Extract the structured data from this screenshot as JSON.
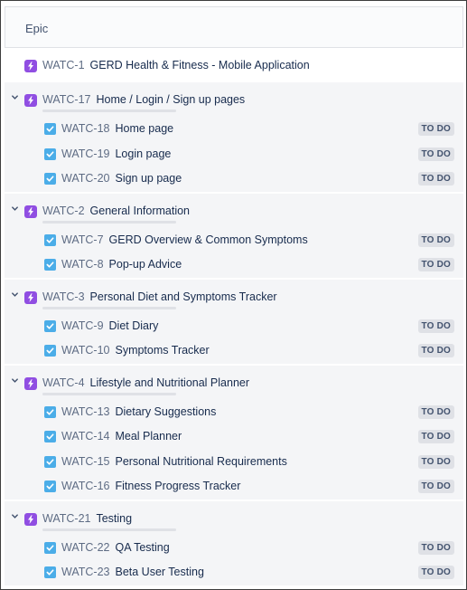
{
  "header": {
    "title": "Epic"
  },
  "epics": [
    {
      "key": "WATC-1",
      "summary": "GERD Health & Fitness - Mobile Application",
      "expanded": false,
      "stories": []
    },
    {
      "key": "WATC-17",
      "summary": "Home / Login / Sign up pages",
      "expanded": true,
      "stories": [
        {
          "key": "WATC-18",
          "summary": "Home page",
          "status": "TO DO"
        },
        {
          "key": "WATC-19",
          "summary": "Login page",
          "status": "TO DO"
        },
        {
          "key": "WATC-20",
          "summary": "Sign up page",
          "status": "TO DO"
        }
      ]
    },
    {
      "key": "WATC-2",
      "summary": "General Information",
      "expanded": true,
      "stories": [
        {
          "key": "WATC-7",
          "summary": "GERD Overview & Common Symptoms",
          "status": "TO DO"
        },
        {
          "key": "WATC-8",
          "summary": "Pop-up Advice",
          "status": "TO DO"
        }
      ]
    },
    {
      "key": "WATC-3",
      "summary": "Personal Diet and Symptoms Tracker",
      "expanded": true,
      "stories": [
        {
          "key": "WATC-9",
          "summary": "Diet Diary",
          "status": "TO DO"
        },
        {
          "key": "WATC-10",
          "summary": "Symptoms Tracker",
          "status": "TO DO"
        }
      ]
    },
    {
      "key": "WATC-4",
      "summary": "Lifestyle and Nutritional Planner",
      "expanded": true,
      "stories": [
        {
          "key": "WATC-13",
          "summary": "Dietary Suggestions",
          "status": "TO DO"
        },
        {
          "key": "WATC-14",
          "summary": "Meal Planner",
          "status": "TO DO"
        },
        {
          "key": "WATC-15",
          "summary": "Personal Nutritional Requirements",
          "status": "TO DO"
        },
        {
          "key": "WATC-16",
          "summary": "Fitness Progress Tracker",
          "status": "TO DO"
        }
      ]
    },
    {
      "key": "WATC-21",
      "summary": "Testing",
      "expanded": true,
      "stories": [
        {
          "key": "WATC-22",
          "summary": "QA Testing",
          "status": "TO DO"
        },
        {
          "key": "WATC-23",
          "summary": "Beta User Testing",
          "status": "TO DO"
        }
      ]
    }
  ],
  "colors": {
    "epic": "#904ee2",
    "story": "#4bade8",
    "badge_bg": "#dfe1e6",
    "row_bg": "#f4f5f7"
  },
  "icons": {
    "epic": "lightning-icon",
    "story": "checkbox-icon",
    "expand": "chevron-down-icon"
  }
}
